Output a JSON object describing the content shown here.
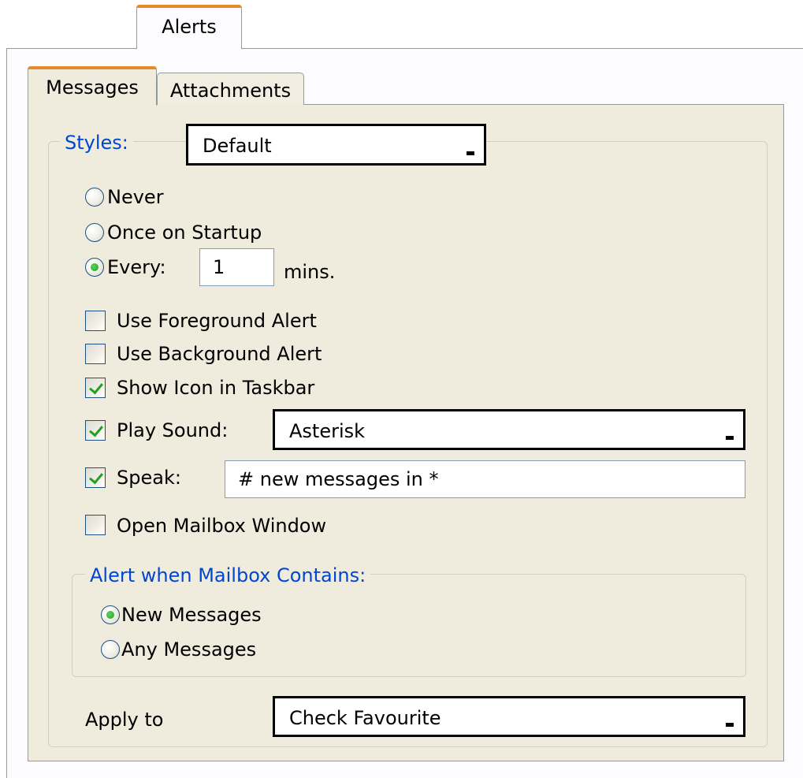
{
  "tabs": {
    "outer": "Alerts",
    "messages": "Messages",
    "attachments": "Attachments"
  },
  "styles": {
    "legend": "Styles:",
    "selected": "Default"
  },
  "frequency": {
    "never": "Never",
    "once": "Once on Startup",
    "every": "Every:",
    "every_value": "1",
    "mins": "mins.",
    "selected": "every"
  },
  "options": {
    "foreground": {
      "label": "Use Foreground Alert",
      "checked": false
    },
    "background": {
      "label": "Use Background Alert",
      "checked": false
    },
    "taskbar": {
      "label": "Show Icon in Taskbar",
      "checked": true
    },
    "sound": {
      "label": "Play Sound:",
      "checked": true,
      "value": "Asterisk"
    },
    "speak": {
      "label": "Speak:",
      "checked": true,
      "value": "# new messages in *"
    },
    "mailbox": {
      "label": "Open Mailbox Window",
      "checked": false
    }
  },
  "contains": {
    "legend": "Alert when Mailbox Contains:",
    "new_messages": "New Messages",
    "any_messages": "Any Messages",
    "selected": "new_messages"
  },
  "apply": {
    "label": "Apply to",
    "value": "Check Favourite"
  },
  "colors": {
    "tab_accent": "#e68b2c",
    "group_legend": "#0046d5",
    "check_green": "#21a121",
    "panel_bg": "#efebdd"
  }
}
